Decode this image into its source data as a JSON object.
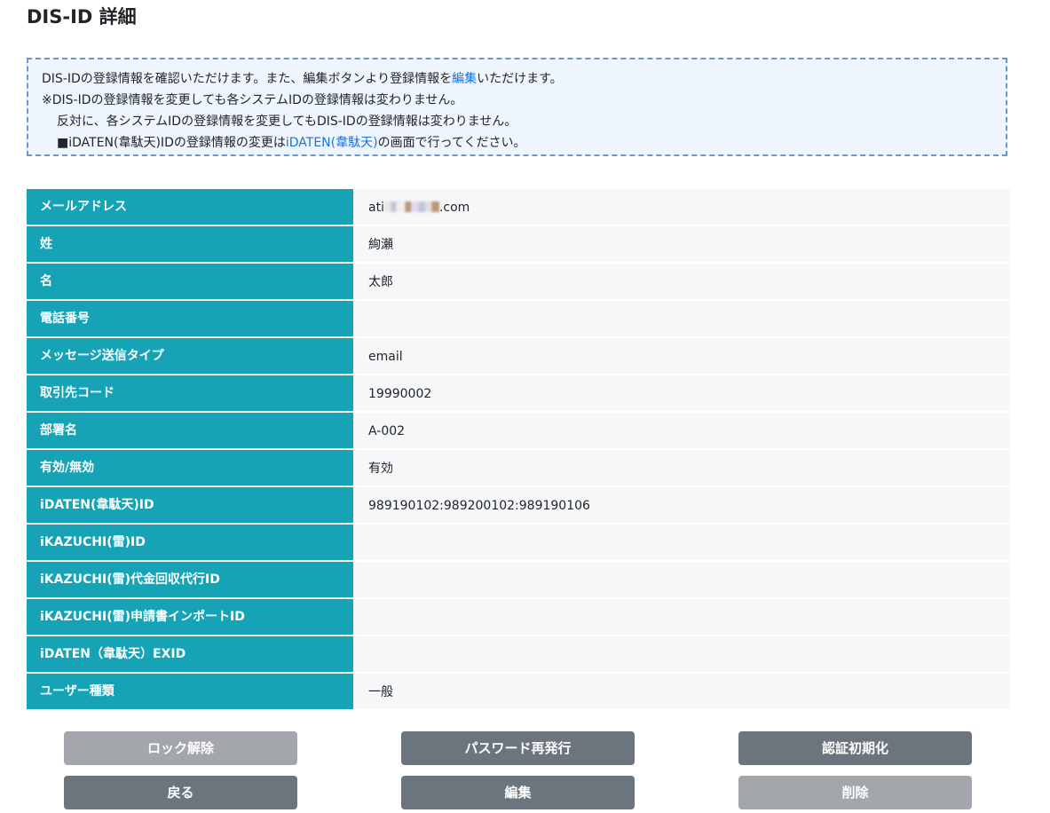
{
  "page": {
    "title": "DIS-ID 詳細"
  },
  "notice": {
    "line1_pre": "DIS-IDの登録情報を確認いただけます。また、編集ボタンより登録情報を",
    "line1_link": "編集",
    "line1_post": "いただけます。",
    "line2": "※DIS-IDの登録情報を変更しても各システムIDの登録情報は変わりません。",
    "line3": "反対に、各システムIDの登録情報を変更してもDIS-IDの登録情報は変わりません。",
    "line4_pre": "■iDATEN(韋駄天)IDの登録情報の変更は",
    "line4_link": "iDATEN(韋駄天)",
    "line4_post": "の画面で行ってください。"
  },
  "details": [
    {
      "label": "メールアドレス",
      "value_pre": "ati",
      "value_post": ".com"
    },
    {
      "label": "姓",
      "value": "絢瀬"
    },
    {
      "label": "名",
      "value": "太郎"
    },
    {
      "label": "電話番号",
      "value": ""
    },
    {
      "label": "メッセージ送信タイプ",
      "value": "email"
    },
    {
      "label": "取引先コード",
      "value": "19990002"
    },
    {
      "label": "部署名",
      "value": "A-002"
    },
    {
      "label": "有効/無効",
      "value": "有効"
    },
    {
      "label": "iDATEN(韋駄天)ID",
      "value": "989190102:989200102:989190106"
    },
    {
      "label": "iKAZUCHI(雷)ID",
      "value": ""
    },
    {
      "label": "iKAZUCHI(雷)代金回収代行ID",
      "value": ""
    },
    {
      "label": "iKAZUCHI(雷)申請書インポートID",
      "value": ""
    },
    {
      "label": "iDATEN（韋駄天）EXID",
      "value": ""
    },
    {
      "label": "ユーザー種類",
      "value": "一般"
    }
  ],
  "buttons": {
    "unlock": "ロック解除",
    "reissue_password": "パスワード再発行",
    "reset_auth": "認証初期化",
    "back": "戻る",
    "edit": "編集",
    "delete": "削除"
  },
  "colors": {
    "label_bg": "#17a3b6",
    "value_bg": "#f5f7f9",
    "button_dark": "#6c757d",
    "button_disabled": "#a3a7ac",
    "link": "#1a73d9",
    "notice_border": "#6c95cf",
    "notice_bg": "#eef5fd"
  }
}
